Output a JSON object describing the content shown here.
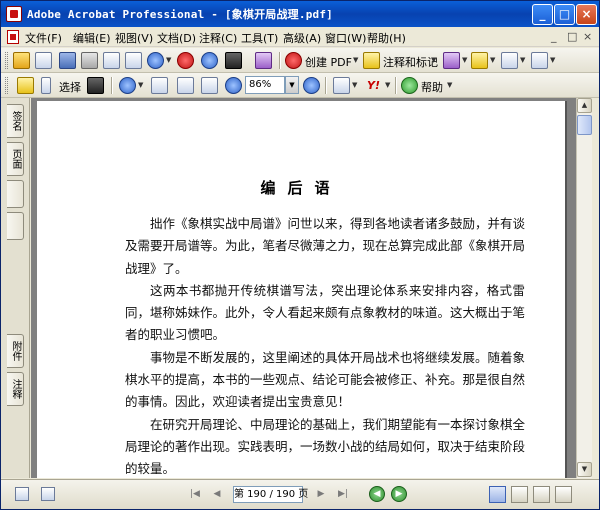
{
  "window": {
    "title": "Adobe Acrobat Professional - [象棋开局战理.pdf]",
    "minimize_label": "_",
    "maximize_label": "□",
    "close_label": "×"
  },
  "menubar": {
    "items": [
      "文件(F)",
      "编辑(E)",
      "视图(V)",
      "文档(D)",
      "注释(C)",
      "工具(T)",
      "高级(A)",
      "窗口(W)",
      "帮助(H)"
    ],
    "mdi_controls": [
      "_",
      "□",
      "×"
    ]
  },
  "toolbar1": {
    "create_pdf_label": "创建 PDF",
    "comment_markup_label": "注释和标记"
  },
  "toolbar2": {
    "select_label": "选择",
    "zoom_value": "86%",
    "help_label": "帮助",
    "yahoo_label": "Y!"
  },
  "navpanel": {
    "tabs": [
      "签名",
      "页面",
      "附件",
      "注释"
    ]
  },
  "document": {
    "heading": "编后语",
    "paragraphs": [
      "拙作《象棋实战中局谱》问世以来，得到各地读者诸多鼓励，并有谈及需要开局谱等。为此，笔者尽微薄之力，现在总算完成此部《象棋开局战理》了。",
      "这两本书都抛开传统棋谱写法，突出理论体系来安排内容，格式雷同，堪称姊妹作。此外，令人看起来颇有点象教材的味道。这大概出于笔者的职业习惯吧。",
      "事物是不断发展的，这里阐述的具体开局战术也将继续发展。随着象棋水平的提高，本书的一些观点、结论可能会被修正、补充。那是很自然的事情。因此，欢迎读者提出宝贵意见！",
      "在研究开局理论、中局理论的基础上，我们期望能有一本探讨象棋全局理论的著作出现。实践表明，一场数小战的结局如何，取决于结束阶段的较量。"
    ]
  },
  "statusbar": {
    "page_display": "第 190 / 190 页",
    "nav_first": "|◀",
    "nav_prev": "◀",
    "nav_next": "▶",
    "nav_last": "▶|"
  }
}
